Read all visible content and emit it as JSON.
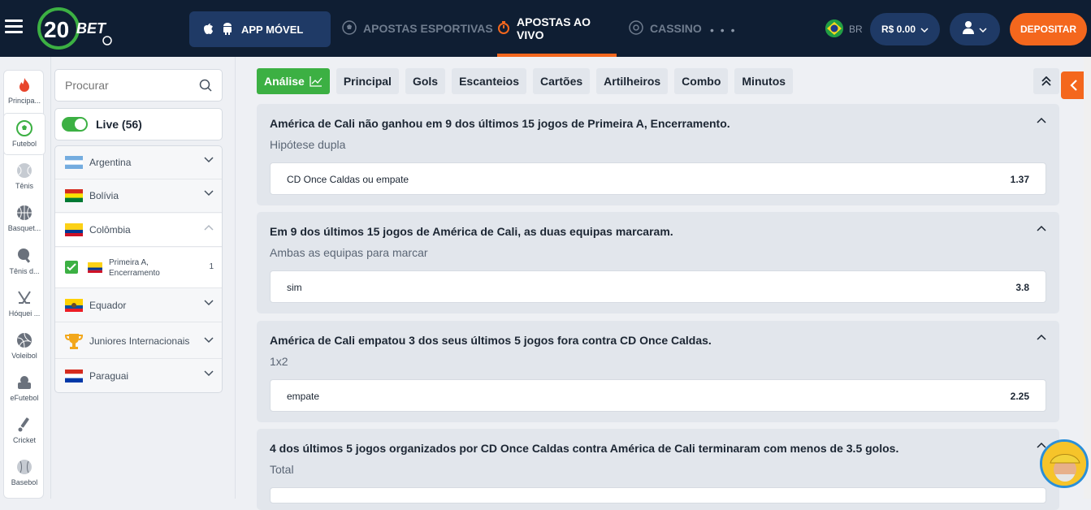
{
  "header": {
    "logo_text": "20BET",
    "app_button": "APP MÓVEL",
    "nav": [
      {
        "label": "APOSTAS ESPORTIVAS"
      },
      {
        "label": "APOSTAS AO VIVO"
      },
      {
        "label": "CASSINO"
      }
    ],
    "more": "• • •",
    "lang": "BR",
    "balance": "R$ 0.00",
    "deposit": "DEPOSITAR"
  },
  "sports": [
    {
      "label": "Principa..."
    },
    {
      "label": "Futebol"
    },
    {
      "label": "Tênis"
    },
    {
      "label": "Basquet..."
    },
    {
      "label": "Tênis d..."
    },
    {
      "label": "Hóquei ..."
    },
    {
      "label": "Voleibol"
    },
    {
      "label": "eFutebol"
    },
    {
      "label": "Cricket"
    },
    {
      "label": "Basebol"
    }
  ],
  "search": {
    "placeholder": "Procurar"
  },
  "live": {
    "label": "Live (56)"
  },
  "countries": [
    {
      "name": "Argentina"
    },
    {
      "name": "Bolívia"
    },
    {
      "name": "Colômbia"
    },
    {
      "name": "Equador"
    },
    {
      "name": "Juniores Internacionais"
    },
    {
      "name": "Paraguai"
    }
  ],
  "league": {
    "name_line1": "Primeira A,",
    "name_line2": "Encerramento",
    "count": "1"
  },
  "tabs": [
    "Análise",
    "Principal",
    "Gols",
    "Escanteios",
    "Cartões",
    "Artilheiros",
    "Combo",
    "Minutos"
  ],
  "cards": [
    {
      "title": "América de Cali não ganhou em 9 dos últimos 15 jogos de Primeira A, Encerramento.",
      "market": "Hipótese dupla",
      "outcome": "CD Once Caldas ou empate",
      "odd": "1.37"
    },
    {
      "title": "Em 9 dos últimos 15 jogos de América de Cali, as duas equipas marcaram.",
      "market": "Ambas as equipas para marcar",
      "outcome": "sim",
      "odd": "3.8"
    },
    {
      "title": "América de Cali empatou 3 dos seus últimos 5 jogos fora contra CD Once Caldas.",
      "market": "1x2",
      "outcome": "empate",
      "odd": "2.25"
    },
    {
      "title": "4 dos últimos 5 jogos organizados por CD Once Caldas contra América de Cali terminaram com menos de 3.5 golos.",
      "market": "Total",
      "outcome": "",
      "odd": ""
    }
  ],
  "colors": {
    "accent": "#f4671d",
    "green": "#3cb043",
    "navy": "#0f1e33"
  }
}
